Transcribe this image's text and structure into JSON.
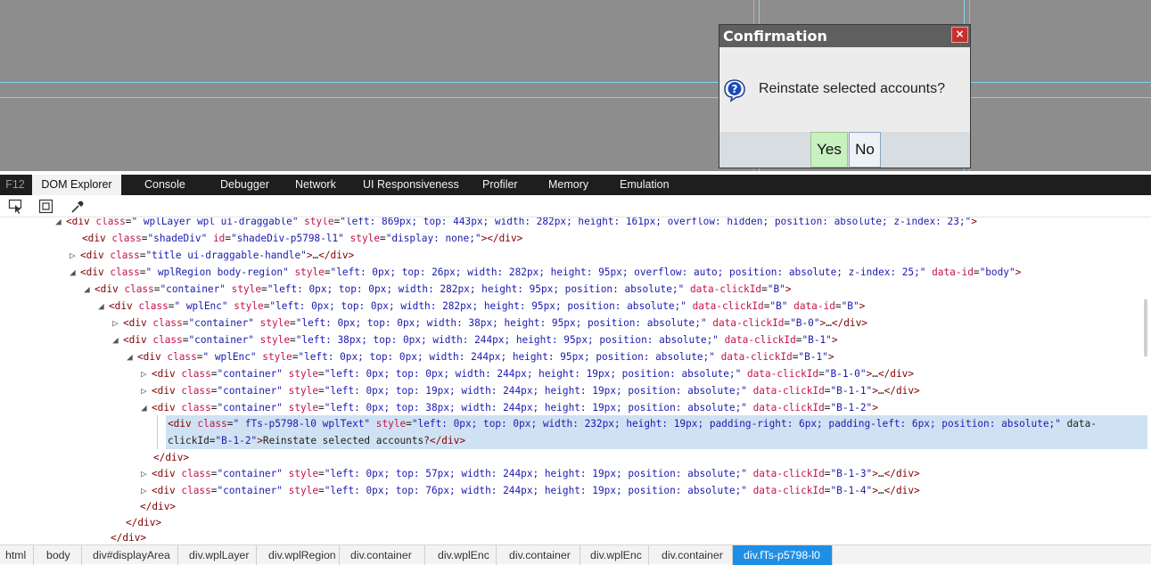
{
  "dialog": {
    "title": "Confirmation",
    "close_glyph": "×",
    "icon": "help-question-icon",
    "message": "Reinstate selected accounts?",
    "yes_label": "Yes",
    "no_label": "No"
  },
  "devtools": {
    "f12_label": "F12",
    "tabs": [
      "DOM Explorer",
      "Console",
      "Debugger",
      "Network",
      "UI Responsiveness",
      "Profiler",
      "Memory",
      "Emulation"
    ],
    "toolbar_icons": [
      "select-element-icon",
      "highlight-box-icon",
      "color-picker-icon"
    ],
    "tree_lines": [
      "<div class=\" wplLayer wpl ui-draggable\" style=\"left: 869px; top: 443px; width: 282px; height: 161px; overflow: hidden; position: absolute; z-index: 23;\">",
      "<div class=\"shadeDiv\" id=\"shadeDiv-p5798-l1\" style=\"display: none;\"></div>",
      "<div class=\"title ui-draggable-handle\">…</div>",
      "<div class=\" wplRegion body-region\" style=\"left: 0px; top: 26px; width: 282px; height: 95px; overflow: auto; position: absolute; z-index: 25;\" data-id=\"body\">",
      "<div class=\"container\" style=\"left: 0px; top: 0px; width: 282px; height: 95px; position: absolute;\" data-clickId=\"B\">",
      "<div class=\" wplEnc\" style=\"left: 0px; top: 0px; width: 282px; height: 95px; position: absolute;\" data-clickId=\"B\" data-id=\"B\">",
      "<div class=\"container\" style=\"left: 0px; top: 0px; width: 38px; height: 95px; position: absolute;\" data-clickId=\"B-0\">…</div>",
      "<div class=\"container\" style=\"left: 38px; top: 0px; width: 244px; height: 95px; position: absolute;\" data-clickId=\"B-1\">",
      "<div class=\" wplEnc\" style=\"left: 0px; top: 0px; width: 244px; height: 95px; position: absolute;\" data-clickId=\"B-1\">",
      "<div class=\"container\" style=\"left: 0px; top: 0px; width: 244px; height: 19px; position: absolute;\" data-clickId=\"B-1-0\">…</div>",
      "<div class=\"container\" style=\"left: 0px; top: 19px; width: 244px; height: 19px; position: absolute;\" data-clickId=\"B-1-1\">…</div>",
      "<div class=\"container\" style=\"left: 0px; top: 38px; width: 244px; height: 19px; position: absolute;\" data-clickId=\"B-1-2\">",
      "<div class=\" fTs-p5798-l0 wplText\" style=\"left: 0px; top: 0px; width: 232px; height: 19px; padding-right: 6px; padding-left: 6px; position: absolute;\" data-",
      "clickId=\"B-1-2\">Reinstate selected accounts?</div>",
      "</div>",
      "<div class=\"container\" style=\"left: 0px; top: 57px; width: 244px; height: 19px; position: absolute;\" data-clickId=\"B-1-3\">…</div>",
      "<div class=\"container\" style=\"left: 0px; top: 76px; width: 244px; height: 19px; position: absolute;\" data-clickId=\"B-1-4\">…</div>",
      "</div>",
      "</div>",
      "</div>"
    ],
    "breadcrumbs": [
      "html",
      "body",
      "div#displayArea",
      "div.wplLayer",
      "div.wplRegion",
      "div.container",
      "div.wplEnc",
      "div.container",
      "div.wplEnc",
      "div.container",
      "div.fTs-p5798-l0"
    ]
  },
  "colors": {
    "stage": "#8d8d8d",
    "dialog_title": "#5f5f5f",
    "yes_button": "#c8f0c0",
    "selection": "#cfe2f3",
    "crumb_active": "#1f8fe6"
  }
}
